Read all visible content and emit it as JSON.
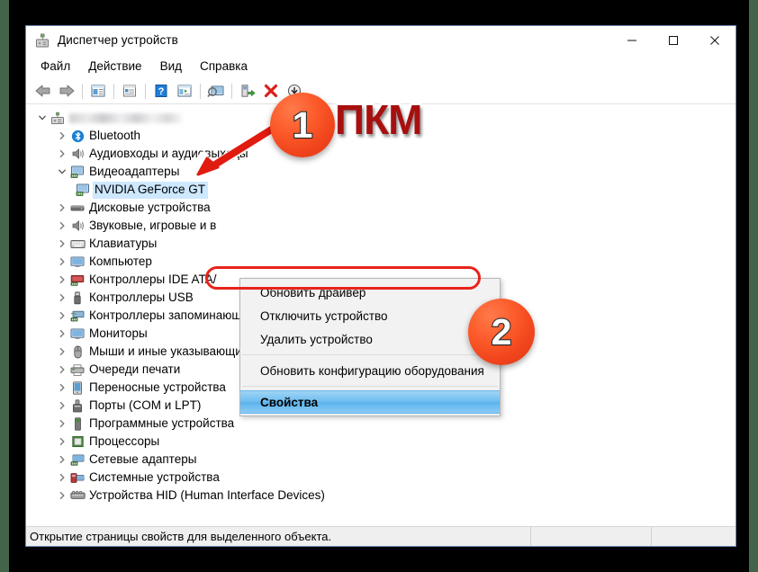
{
  "window": {
    "title": "Диспетчер устройств",
    "title_icon": "device-manager-icon",
    "minimize_label": "—",
    "maximize_label": "❐",
    "close_label": "✕"
  },
  "menubar": {
    "items": [
      {
        "label": "Файл"
      },
      {
        "label": "Действие"
      },
      {
        "label": "Вид"
      },
      {
        "label": "Справка"
      }
    ]
  },
  "toolbar": {
    "buttons": [
      {
        "name": "back-icon"
      },
      {
        "name": "forward-icon"
      },
      {
        "name": "sep"
      },
      {
        "name": "properties-window-icon"
      },
      {
        "name": "sep"
      },
      {
        "name": "show-hidden-devices-icon"
      },
      {
        "name": "sep"
      },
      {
        "name": "help-icon"
      },
      {
        "name": "device-properties-icon"
      },
      {
        "name": "sep"
      },
      {
        "name": "scan-hardware-changes-icon"
      },
      {
        "name": "sep"
      },
      {
        "name": "update-driver-icon"
      },
      {
        "name": "uninstall-device-icon"
      },
      {
        "name": "disable-device-icon"
      }
    ]
  },
  "tree": {
    "root": {
      "label": "",
      "redacted": true,
      "icon": "computer-icon",
      "expanded": true
    },
    "items": [
      {
        "label": "Bluetooth",
        "icon": "bluetooth-icon",
        "expanded": false,
        "level": 1
      },
      {
        "label": "Аудиовходы и аудиовыходы",
        "icon": "audio-icon",
        "expanded": false,
        "level": 1
      },
      {
        "label": "Видеоадаптеры",
        "icon": "display-adapter-icon",
        "expanded": true,
        "level": 1
      },
      {
        "label": "NVIDIA GeForce GT",
        "icon": "display-adapter-icon",
        "expanded": null,
        "level": 2,
        "selected": true
      },
      {
        "label": "Дисковые устройства",
        "icon": "disk-drive-icon",
        "expanded": false,
        "level": 1
      },
      {
        "label": "Звуковые, игровые и в",
        "icon": "audio-icon",
        "expanded": false,
        "level": 1
      },
      {
        "label": "Клавиатуры",
        "icon": "keyboard-icon",
        "expanded": false,
        "level": 1
      },
      {
        "label": "Компьютер",
        "icon": "monitor-icon",
        "expanded": false,
        "level": 1
      },
      {
        "label": "Контроллеры IDE ATA/",
        "icon": "ide-controller-icon",
        "expanded": false,
        "level": 1
      },
      {
        "label": "Контроллеры USB",
        "icon": "usb-icon",
        "expanded": false,
        "level": 1
      },
      {
        "label": "Контроллеры запоминающих устройств",
        "icon": "storage-controller-icon",
        "expanded": false,
        "level": 1
      },
      {
        "label": "Мониторы",
        "icon": "monitor-icon",
        "expanded": false,
        "level": 1
      },
      {
        "label": "Мыши и иные указывающие устройства",
        "icon": "mouse-icon",
        "expanded": false,
        "level": 1
      },
      {
        "label": "Очереди печати",
        "icon": "printer-icon",
        "expanded": false,
        "level": 1
      },
      {
        "label": "Переносные устройства",
        "icon": "portable-device-icon",
        "expanded": false,
        "level": 1
      },
      {
        "label": "Порты (COM и LPT)",
        "icon": "port-icon",
        "expanded": false,
        "level": 1
      },
      {
        "label": "Программные устройства",
        "icon": "software-device-icon",
        "expanded": false,
        "level": 1
      },
      {
        "label": "Процессоры",
        "icon": "processor-icon",
        "expanded": false,
        "level": 1
      },
      {
        "label": "Сетевые адаптеры",
        "icon": "network-adapter-icon",
        "expanded": false,
        "level": 1
      },
      {
        "label": "Системные устройства",
        "icon": "system-device-icon",
        "expanded": false,
        "level": 1
      },
      {
        "label": "Устройства HID (Human Interface Devices)",
        "icon": "hid-icon",
        "expanded": false,
        "level": 1
      }
    ]
  },
  "context_menu": {
    "items": [
      {
        "label": "Обновить драйвер",
        "type": "item"
      },
      {
        "label": "Отключить устройство",
        "type": "item"
      },
      {
        "label": "Удалить устройство",
        "type": "item"
      },
      {
        "type": "separator"
      },
      {
        "label": "Обновить конфигурацию оборудования",
        "type": "item"
      },
      {
        "type": "separator"
      },
      {
        "label": "Свойства",
        "type": "item",
        "highlighted": true
      }
    ]
  },
  "statusbar": {
    "text": "Открытие страницы свойств для выделенного объекта."
  },
  "annotations": {
    "badge1": "1",
    "badge2": "2",
    "hint": "ПКМ",
    "colors": {
      "badge": "#f0441c",
      "hint_text": "#a81010",
      "highlight_ring": "#e8231a",
      "arrow": "#e11b10"
    }
  }
}
